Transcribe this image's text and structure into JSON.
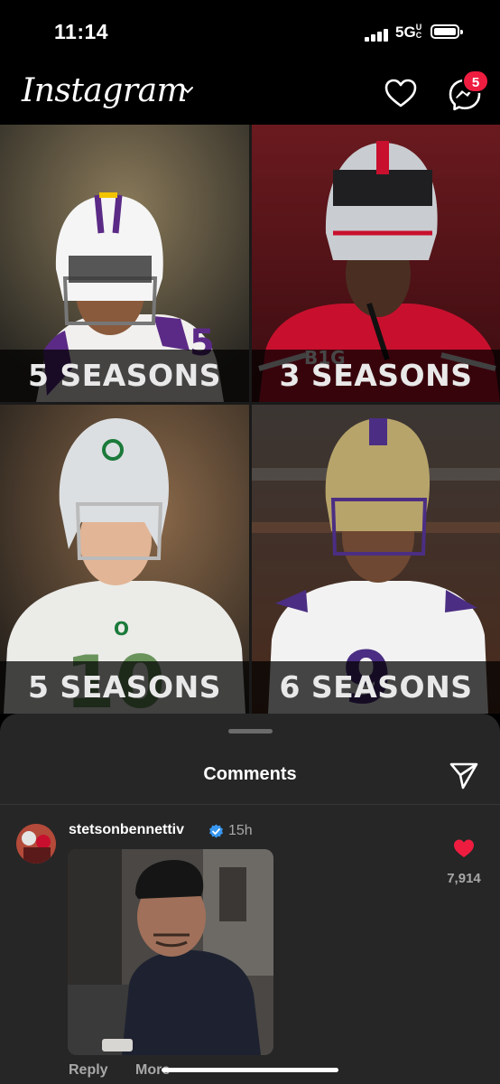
{
  "status_bar": {
    "time": "11:14",
    "network": "5G",
    "network_sub": "UC"
  },
  "header": {
    "logo_text": "Instagram",
    "notification_badge": "5"
  },
  "post": {
    "tiles": [
      {
        "label": "5 SEASONS",
        "jersey_color": "#f4f2f2",
        "accent": "#5b2a86"
      },
      {
        "label": "3 SEASONS",
        "jersey_color": "#c8102e",
        "accent": "#b0b7bc"
      },
      {
        "label": "5 SEASONS",
        "jersey_color": "#eeeeee",
        "accent": "#1b7a3a"
      },
      {
        "label": "6 SEASONS",
        "jersey_color": "#f2f2f2",
        "accent": "#4b2e83"
      }
    ]
  },
  "comments_sheet": {
    "title": "Comments",
    "comment": {
      "username": "stetsonbennettiv",
      "time": "15h",
      "like_count": "7,914",
      "reply_label": "Reply",
      "more_label": "More"
    }
  },
  "colors": {
    "badge": "#ee1d40",
    "verified": "#3897f0",
    "like": "#ee1d40",
    "sheet_bg": "#262626"
  }
}
